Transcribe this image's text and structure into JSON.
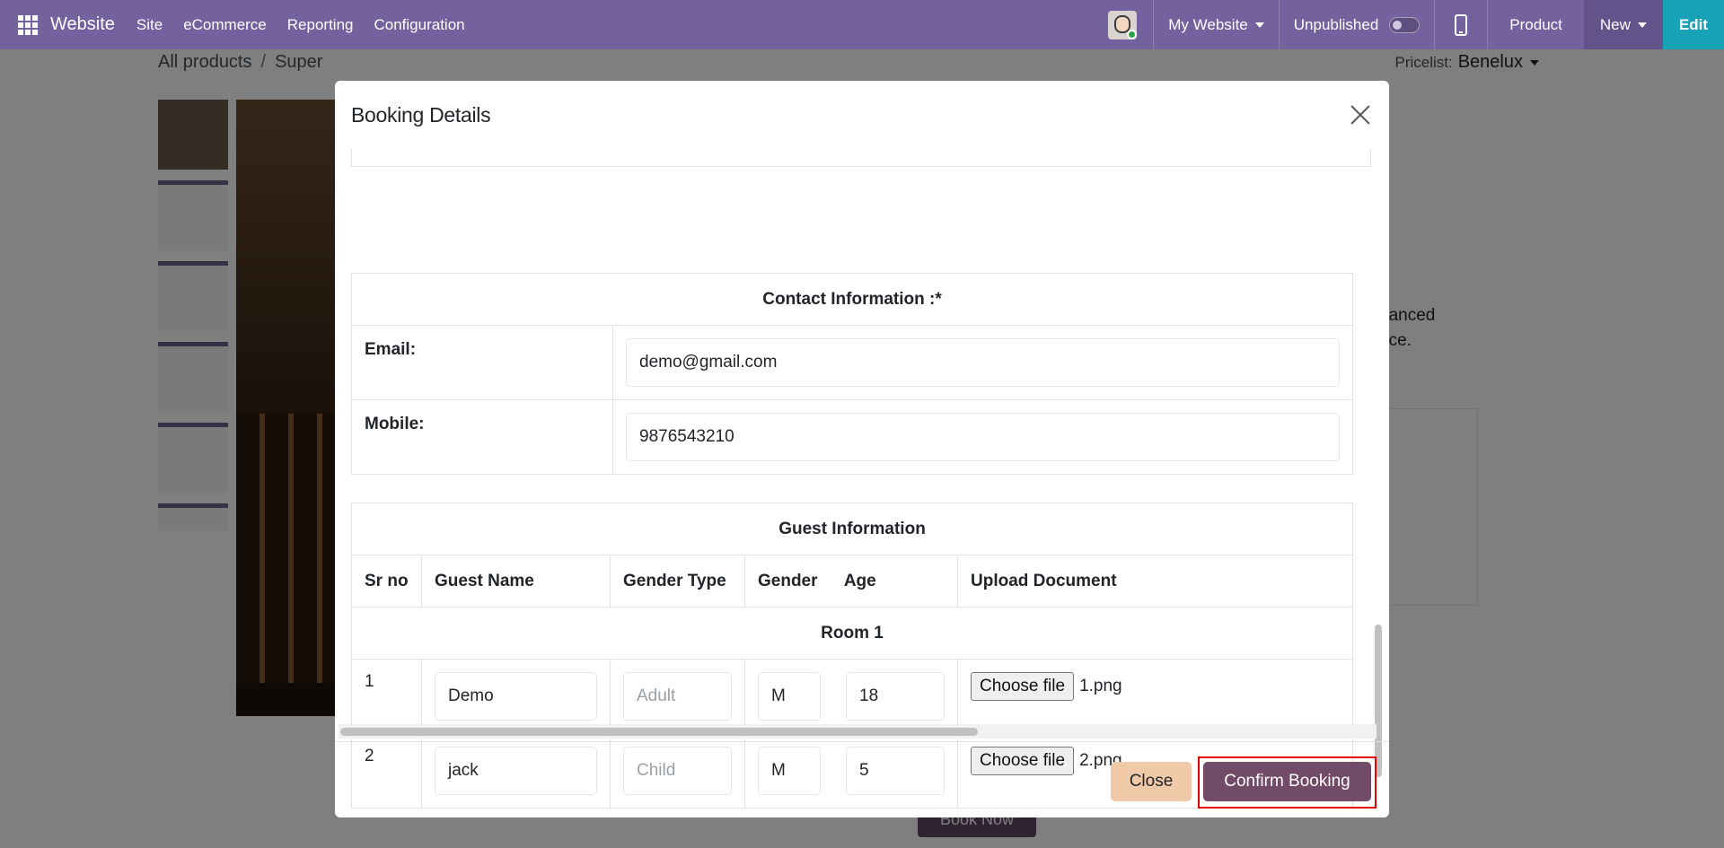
{
  "navbar": {
    "brand": "Website",
    "menu": [
      "Site",
      "eCommerce",
      "Reporting",
      "Configuration"
    ],
    "my_website": "My Website",
    "publish_status": "Unpublished",
    "product_label": "Product",
    "new_label": "New",
    "edit_label": "Edit",
    "colors": {
      "bar": "#74629e",
      "edit": "#17a2b8"
    }
  },
  "page": {
    "breadcrumb": [
      "All products",
      "Super"
    ],
    "pricelist_label": "Pricelist:",
    "pricelist_value": "Benelux",
    "side_text": [
      "hanced",
      "nce."
    ],
    "book_now_label": "Book Now"
  },
  "modal": {
    "title": "Booking Details",
    "contact": {
      "heading": "Contact Information :*",
      "email_label": "Email:",
      "email_value": "demo@gmail.com",
      "mobile_label": "Mobile:",
      "mobile_value": "9876543210"
    },
    "guests": {
      "heading": "Guest Information",
      "columns": [
        "Sr no",
        "Guest Name",
        "Gender Type",
        "Gender",
        "Age",
        "Upload Document"
      ],
      "room_label": "Room 1",
      "file_button_label": "Choose file",
      "rows": [
        {
          "sr": "1",
          "name": "Demo",
          "gender_type": "Adult",
          "gender": "M",
          "age": "18",
          "file": "1.png"
        },
        {
          "sr": "2",
          "name": "jack",
          "gender_type": "Child",
          "gender": "M",
          "age": "5",
          "file": "2.png"
        }
      ]
    },
    "footer": {
      "close_label": "Close",
      "confirm_label": "Confirm Booking",
      "colors": {
        "close": "#f0c9a8",
        "confirm": "#714b67",
        "highlight": "#e30000"
      }
    }
  }
}
